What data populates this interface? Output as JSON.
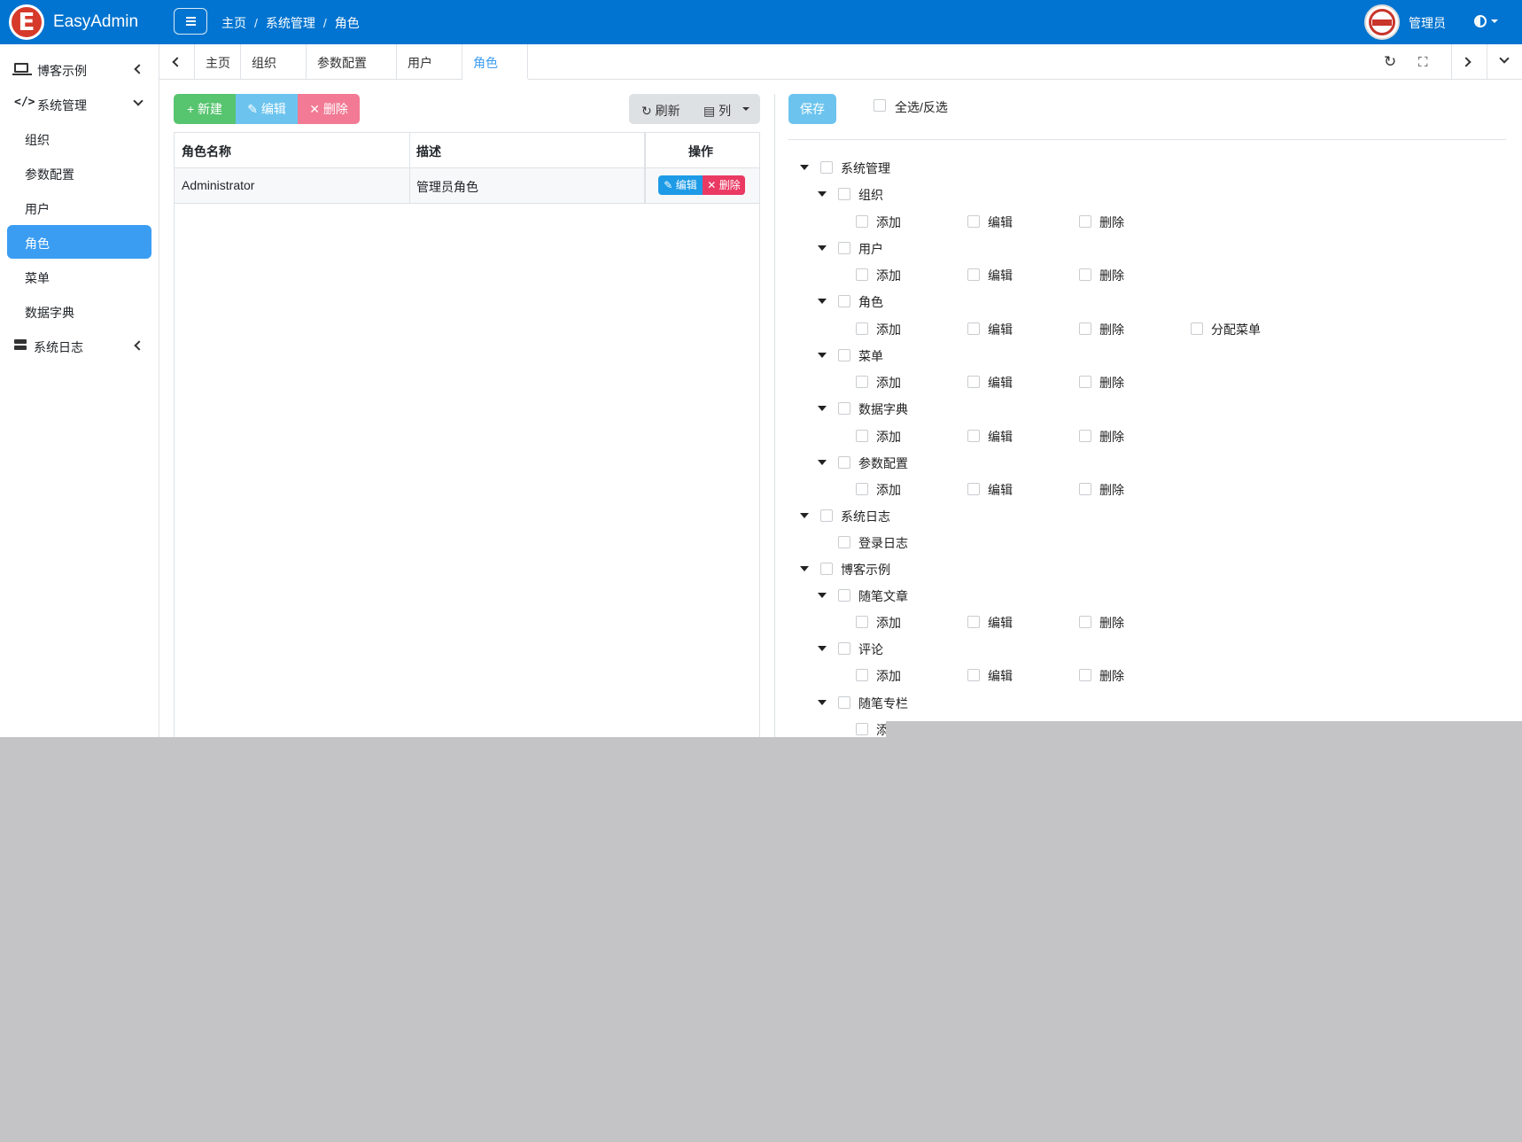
{
  "header": {
    "logo_letter": "E",
    "app_name": "EasyAdmin",
    "breadcrumb": [
      "主页",
      "系统管理",
      "角色"
    ],
    "user_name": "管理员",
    "brand_color": "#0074d0"
  },
  "sidebar": {
    "items": [
      {
        "label": "博客示例",
        "icon": "laptop-icon",
        "type": "parent",
        "state": "collapsed"
      },
      {
        "label": "系统管理",
        "icon": "code-icon",
        "type": "parent",
        "state": "expanded"
      },
      {
        "label": "组织"
      },
      {
        "label": "参数配置"
      },
      {
        "label": "用户"
      },
      {
        "label": "角色",
        "active": true
      },
      {
        "label": "菜单"
      },
      {
        "label": "数据字典"
      },
      {
        "label": "系统日志",
        "icon": "server-icon",
        "type": "parent",
        "state": "collapsed"
      }
    ],
    "active_color": "#3b9df2"
  },
  "tabs": {
    "items": [
      "主页",
      "组织",
      "参数配置",
      "用户",
      "角色"
    ],
    "active": "角色"
  },
  "toolbar": {
    "new_label": "新建",
    "edit_label": "编辑",
    "delete_label": "删除",
    "refresh_label": "刷新",
    "columns_label": "列"
  },
  "table": {
    "columns": [
      "角色名称",
      "描述",
      "操作"
    ],
    "rows": [
      {
        "name": "Administrator",
        "desc": "管理员角色",
        "edit": "编辑",
        "delete": "删除"
      }
    ]
  },
  "perm": {
    "save_label": "保存",
    "select_all_label": "全选/反选",
    "tree": [
      {
        "label": "系统管理",
        "children": [
          {
            "label": "组织",
            "actions": [
              "添加",
              "编辑",
              "删除"
            ]
          },
          {
            "label": "用户",
            "actions": [
              "添加",
              "编辑",
              "删除"
            ]
          },
          {
            "label": "角色",
            "actions": [
              "添加",
              "编辑",
              "删除",
              "分配菜单"
            ]
          },
          {
            "label": "菜单",
            "actions": [
              "添加",
              "编辑",
              "删除"
            ]
          },
          {
            "label": "数据字典",
            "actions": [
              "添加",
              "编辑",
              "删除"
            ]
          },
          {
            "label": "参数配置",
            "actions": [
              "添加",
              "编辑",
              "删除"
            ]
          }
        ]
      },
      {
        "label": "系统日志",
        "children": [
          {
            "label": "登录日志",
            "actions": []
          }
        ]
      },
      {
        "label": "博客示例",
        "children": [
          {
            "label": "随笔文章",
            "actions": [
              "添加",
              "编辑",
              "删除"
            ]
          },
          {
            "label": "评论",
            "actions": [
              "添加",
              "编辑",
              "删除"
            ]
          },
          {
            "label": "随笔专栏",
            "actions": [
              "添"
            ]
          }
        ]
      }
    ]
  }
}
